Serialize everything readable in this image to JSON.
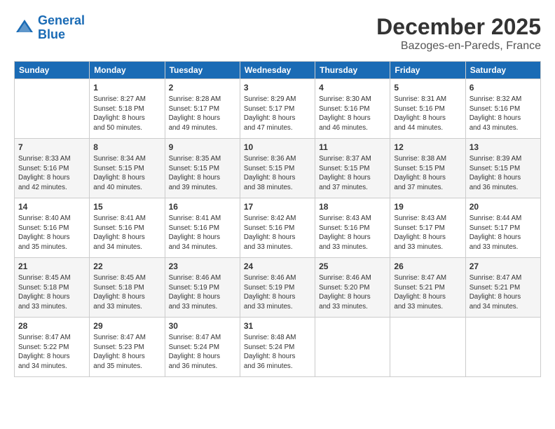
{
  "header": {
    "logo_line1": "General",
    "logo_line2": "Blue",
    "month": "December 2025",
    "location": "Bazoges-en-Pareds, France"
  },
  "days_of_week": [
    "Sunday",
    "Monday",
    "Tuesday",
    "Wednesday",
    "Thursday",
    "Friday",
    "Saturday"
  ],
  "weeks": [
    [
      {
        "day": "",
        "content": ""
      },
      {
        "day": "1",
        "content": "Sunrise: 8:27 AM\nSunset: 5:18 PM\nDaylight: 8 hours\nand 50 minutes."
      },
      {
        "day": "2",
        "content": "Sunrise: 8:28 AM\nSunset: 5:17 PM\nDaylight: 8 hours\nand 49 minutes."
      },
      {
        "day": "3",
        "content": "Sunrise: 8:29 AM\nSunset: 5:17 PM\nDaylight: 8 hours\nand 47 minutes."
      },
      {
        "day": "4",
        "content": "Sunrise: 8:30 AM\nSunset: 5:16 PM\nDaylight: 8 hours\nand 46 minutes."
      },
      {
        "day": "5",
        "content": "Sunrise: 8:31 AM\nSunset: 5:16 PM\nDaylight: 8 hours\nand 44 minutes."
      },
      {
        "day": "6",
        "content": "Sunrise: 8:32 AM\nSunset: 5:16 PM\nDaylight: 8 hours\nand 43 minutes."
      }
    ],
    [
      {
        "day": "7",
        "content": "Sunrise: 8:33 AM\nSunset: 5:16 PM\nDaylight: 8 hours\nand 42 minutes."
      },
      {
        "day": "8",
        "content": "Sunrise: 8:34 AM\nSunset: 5:15 PM\nDaylight: 8 hours\nand 40 minutes."
      },
      {
        "day": "9",
        "content": "Sunrise: 8:35 AM\nSunset: 5:15 PM\nDaylight: 8 hours\nand 39 minutes."
      },
      {
        "day": "10",
        "content": "Sunrise: 8:36 AM\nSunset: 5:15 PM\nDaylight: 8 hours\nand 38 minutes."
      },
      {
        "day": "11",
        "content": "Sunrise: 8:37 AM\nSunset: 5:15 PM\nDaylight: 8 hours\nand 37 minutes."
      },
      {
        "day": "12",
        "content": "Sunrise: 8:38 AM\nSunset: 5:15 PM\nDaylight: 8 hours\nand 37 minutes."
      },
      {
        "day": "13",
        "content": "Sunrise: 8:39 AM\nSunset: 5:15 PM\nDaylight: 8 hours\nand 36 minutes."
      }
    ],
    [
      {
        "day": "14",
        "content": "Sunrise: 8:40 AM\nSunset: 5:16 PM\nDaylight: 8 hours\nand 35 minutes."
      },
      {
        "day": "15",
        "content": "Sunrise: 8:41 AM\nSunset: 5:16 PM\nDaylight: 8 hours\nand 34 minutes."
      },
      {
        "day": "16",
        "content": "Sunrise: 8:41 AM\nSunset: 5:16 PM\nDaylight: 8 hours\nand 34 minutes."
      },
      {
        "day": "17",
        "content": "Sunrise: 8:42 AM\nSunset: 5:16 PM\nDaylight: 8 hours\nand 33 minutes."
      },
      {
        "day": "18",
        "content": "Sunrise: 8:43 AM\nSunset: 5:16 PM\nDaylight: 8 hours\nand 33 minutes."
      },
      {
        "day": "19",
        "content": "Sunrise: 8:43 AM\nSunset: 5:17 PM\nDaylight: 8 hours\nand 33 minutes."
      },
      {
        "day": "20",
        "content": "Sunrise: 8:44 AM\nSunset: 5:17 PM\nDaylight: 8 hours\nand 33 minutes."
      }
    ],
    [
      {
        "day": "21",
        "content": "Sunrise: 8:45 AM\nSunset: 5:18 PM\nDaylight: 8 hours\nand 33 minutes."
      },
      {
        "day": "22",
        "content": "Sunrise: 8:45 AM\nSunset: 5:18 PM\nDaylight: 8 hours\nand 33 minutes."
      },
      {
        "day": "23",
        "content": "Sunrise: 8:46 AM\nSunset: 5:19 PM\nDaylight: 8 hours\nand 33 minutes."
      },
      {
        "day": "24",
        "content": "Sunrise: 8:46 AM\nSunset: 5:19 PM\nDaylight: 8 hours\nand 33 minutes."
      },
      {
        "day": "25",
        "content": "Sunrise: 8:46 AM\nSunset: 5:20 PM\nDaylight: 8 hours\nand 33 minutes."
      },
      {
        "day": "26",
        "content": "Sunrise: 8:47 AM\nSunset: 5:21 PM\nDaylight: 8 hours\nand 33 minutes."
      },
      {
        "day": "27",
        "content": "Sunrise: 8:47 AM\nSunset: 5:21 PM\nDaylight: 8 hours\nand 34 minutes."
      }
    ],
    [
      {
        "day": "28",
        "content": "Sunrise: 8:47 AM\nSunset: 5:22 PM\nDaylight: 8 hours\nand 34 minutes."
      },
      {
        "day": "29",
        "content": "Sunrise: 8:47 AM\nSunset: 5:23 PM\nDaylight: 8 hours\nand 35 minutes."
      },
      {
        "day": "30",
        "content": "Sunrise: 8:47 AM\nSunset: 5:24 PM\nDaylight: 8 hours\nand 36 minutes."
      },
      {
        "day": "31",
        "content": "Sunrise: 8:48 AM\nSunset: 5:24 PM\nDaylight: 8 hours\nand 36 minutes."
      },
      {
        "day": "",
        "content": ""
      },
      {
        "day": "",
        "content": ""
      },
      {
        "day": "",
        "content": ""
      }
    ]
  ]
}
